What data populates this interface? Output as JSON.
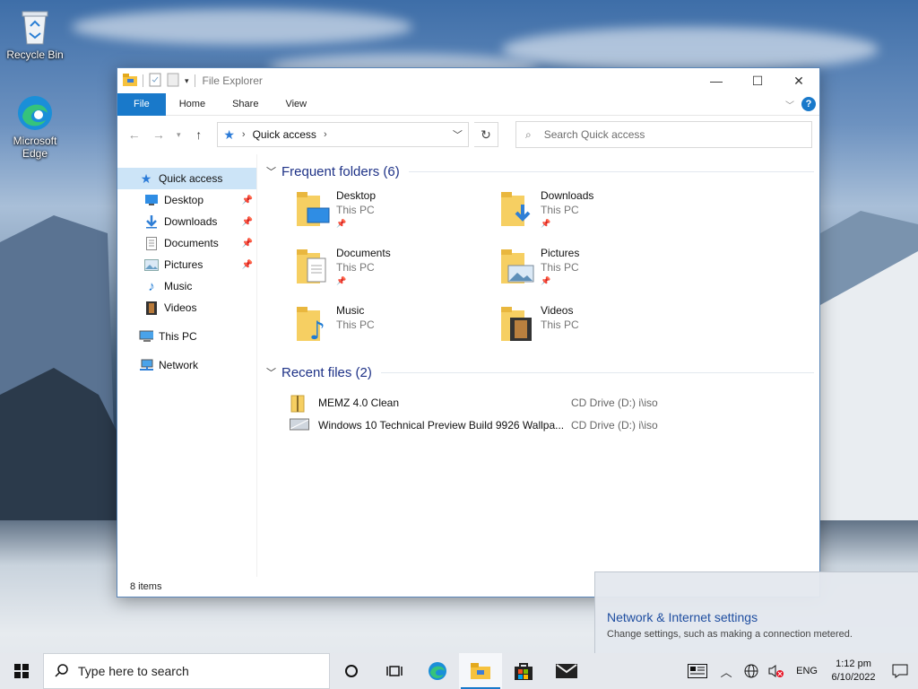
{
  "desktop": {
    "icons": [
      {
        "label": "Recycle Bin",
        "icon": "recycle-bin-icon"
      },
      {
        "label": "Microsoft Edge",
        "icon": "edge-icon"
      }
    ]
  },
  "window": {
    "title": "File Explorer",
    "tabs": [
      "File",
      "Home",
      "Share",
      "View"
    ],
    "help_label": "?",
    "address": {
      "crumb": "Quick access"
    },
    "search": {
      "placeholder": "Search Quick access"
    },
    "nav_pane": [
      {
        "label": "Quick access",
        "icon": "star-icon",
        "selected": true
      },
      {
        "label": "Desktop",
        "icon": "desktop-icon",
        "pinned": true
      },
      {
        "label": "Downloads",
        "icon": "download-icon",
        "pinned": true
      },
      {
        "label": "Documents",
        "icon": "documents-icon",
        "pinned": true
      },
      {
        "label": "Pictures",
        "icon": "pictures-icon",
        "pinned": true
      },
      {
        "label": "Music",
        "icon": "music-icon"
      },
      {
        "label": "Videos",
        "icon": "videos-icon"
      },
      {
        "label": "This PC",
        "icon": "this-pc-icon"
      },
      {
        "label": "Network",
        "icon": "network-icon"
      }
    ],
    "frequent": {
      "header": "Frequent folders (6)",
      "folders": [
        {
          "name": "Desktop",
          "location": "This PC",
          "pinned": true
        },
        {
          "name": "Downloads",
          "location": "This PC",
          "pinned": true
        },
        {
          "name": "Documents",
          "location": "This PC",
          "pinned": true
        },
        {
          "name": "Pictures",
          "location": "This PC",
          "pinned": true
        },
        {
          "name": "Music",
          "location": "This PC",
          "pinned": false
        },
        {
          "name": "Videos",
          "location": "This PC",
          "pinned": false
        }
      ]
    },
    "recent": {
      "header": "Recent files (2)",
      "files": [
        {
          "name": "MEMZ 4.0 Clean",
          "path": "CD Drive (D:) i\\iso"
        },
        {
          "name": "Windows 10 Technical Preview Build 9926 Wallpa...",
          "path": "CD Drive (D:) i\\iso"
        }
      ]
    },
    "status": "8 items"
  },
  "flyout": {
    "title": "Network & Internet settings",
    "subtitle": "Change settings, such as making a connection metered."
  },
  "taskbar": {
    "search_placeholder": "Type here to search",
    "language": "ENG",
    "time": "1:12 pm",
    "date": "6/10/2022"
  },
  "colors": {
    "accent": "#1979ca",
    "link": "#1e3287",
    "selection": "#cce4f7"
  }
}
